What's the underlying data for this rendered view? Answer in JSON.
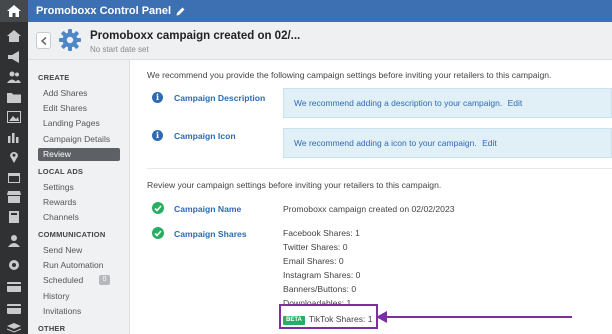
{
  "app": {
    "title": "Promoboxx Control Panel"
  },
  "campaign": {
    "title": "Promoboxx campaign created on 02/...",
    "subtitle": "No start date set"
  },
  "sidebar": {
    "sections": [
      {
        "label": "CREATE",
        "items": [
          {
            "label": "Add Shares"
          },
          {
            "label": "Edit Shares"
          },
          {
            "label": "Landing Pages"
          },
          {
            "label": "Campaign Details"
          },
          {
            "label": "Review",
            "active": true
          }
        ]
      },
      {
        "label": "LOCAL ADS",
        "items": [
          {
            "label": "Settings"
          },
          {
            "label": "Rewards"
          },
          {
            "label": "Channels"
          }
        ]
      },
      {
        "label": "COMMUNICATION",
        "items": [
          {
            "label": "Send New"
          },
          {
            "label": "Run Automation"
          },
          {
            "label": "Scheduled",
            "badge": "0"
          },
          {
            "label": "History"
          },
          {
            "label": "Invitations"
          }
        ]
      },
      {
        "label": "OTHER",
        "items": []
      }
    ]
  },
  "main": {
    "recommend_text": "We recommend you provide the following campaign settings before inviting your retailers to this campaign.",
    "recommendations": [
      {
        "label": "Campaign Description",
        "message": "We recommend adding a description to your campaign.",
        "edit": "Edit"
      },
      {
        "label": "Campaign Icon",
        "message": "We recommend adding a icon to your campaign.",
        "edit": "Edit"
      }
    ],
    "review_text": "Review your campaign settings before inviting your retailers to this campaign.",
    "review": {
      "name_label": "Campaign Name",
      "name_value": "Promoboxx campaign created on 02/02/2023",
      "shares_label": "Campaign Shares",
      "shares": [
        "Facebook Shares: 1",
        "Twitter Shares: 0",
        "Email Shares: 0",
        "Instagram Shares: 0",
        "Banners/Buttons: 0",
        "Downloadables: 1"
      ],
      "tiktok": {
        "badge": "BETA",
        "label": "TikTok Shares: 1"
      }
    }
  },
  "colors": {
    "topbar": "#3c70b3",
    "rail": "#2f3133",
    "accent_blue": "#2d6bb3",
    "success_green": "#27ae60",
    "highlight_purple": "#7b2fa0"
  }
}
